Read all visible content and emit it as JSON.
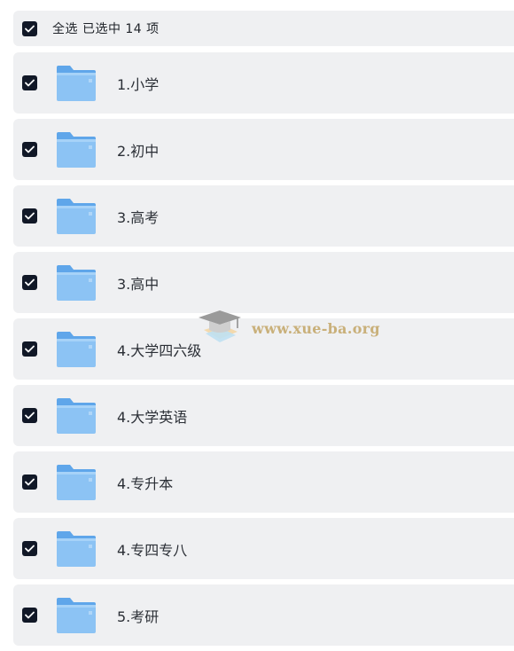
{
  "header": {
    "select_all_label": "全选 已选中 14 项"
  },
  "icons": {
    "checkbox": "checkbox-checked-icon",
    "folder": "folder-icon",
    "watermark": "graduation-cap-icon"
  },
  "colors": {
    "row_background": "#eff0f2",
    "checkbox_fill": "#111827",
    "folder_front": "#8cc3f4",
    "folder_back": "#5fa6ea"
  },
  "items": [
    {
      "label": "1.小学"
    },
    {
      "label": "2.初中"
    },
    {
      "label": "3.高考"
    },
    {
      "label": "3.高中"
    },
    {
      "label": "4.大学四六级"
    },
    {
      "label": "4.大学英语"
    },
    {
      "label": "4.专升本"
    },
    {
      "label": "4.专四专八"
    },
    {
      "label": "5.考研"
    }
  ],
  "watermark": {
    "text": "www.xue-ba.org"
  }
}
